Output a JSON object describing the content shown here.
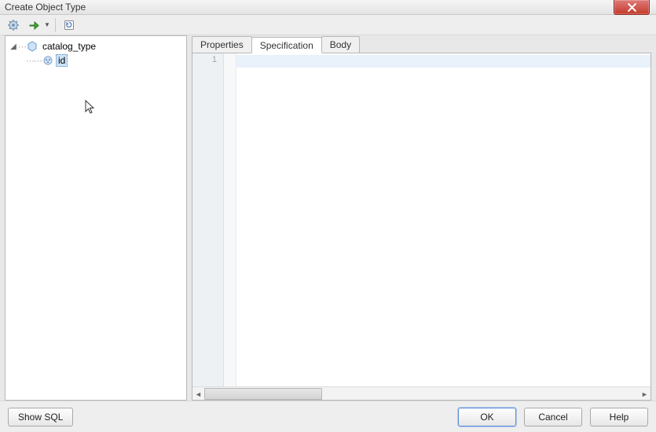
{
  "window": {
    "title": "Create Object Type"
  },
  "toolbar": {
    "icons": {
      "gear": "gear-icon",
      "go": "go-green-arrow-icon",
      "refresh": "refresh-icon"
    }
  },
  "tree": {
    "root": {
      "label": "catalog_type",
      "expanded": true
    },
    "child": {
      "label": "id",
      "selected": true
    }
  },
  "tabs": {
    "items": [
      {
        "label": "Properties",
        "active": false
      },
      {
        "label": "Specification",
        "active": true
      },
      {
        "label": "Body",
        "active": false
      }
    ]
  },
  "editor": {
    "gutter": [
      "1"
    ],
    "content": ""
  },
  "buttons": {
    "show_sql": "Show SQL",
    "ok": "OK",
    "cancel": "Cancel",
    "help": "Help"
  }
}
